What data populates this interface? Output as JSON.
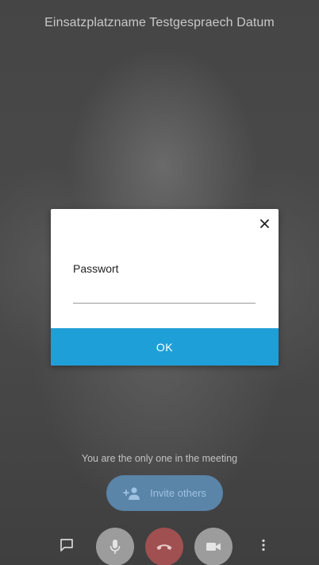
{
  "meeting": {
    "title": "Einsatzplatzname Testgespraech Datum",
    "status_text": "You are the only one in the meeting",
    "invite_label": "Invite others"
  },
  "dialog": {
    "field_label": "Passwort",
    "password_value": "",
    "ok_label": "OK",
    "close_icon": "close-icon"
  },
  "toolbar": {
    "icons": [
      "chat-icon",
      "microphone-icon",
      "hangup-icon",
      "camera-icon",
      "more-vertical-icon"
    ]
  },
  "colors": {
    "accent": "#1f9fd8",
    "invite": "#5a84a8",
    "hangup": "#a05050",
    "toolbar_button": "#9c9c9c"
  }
}
